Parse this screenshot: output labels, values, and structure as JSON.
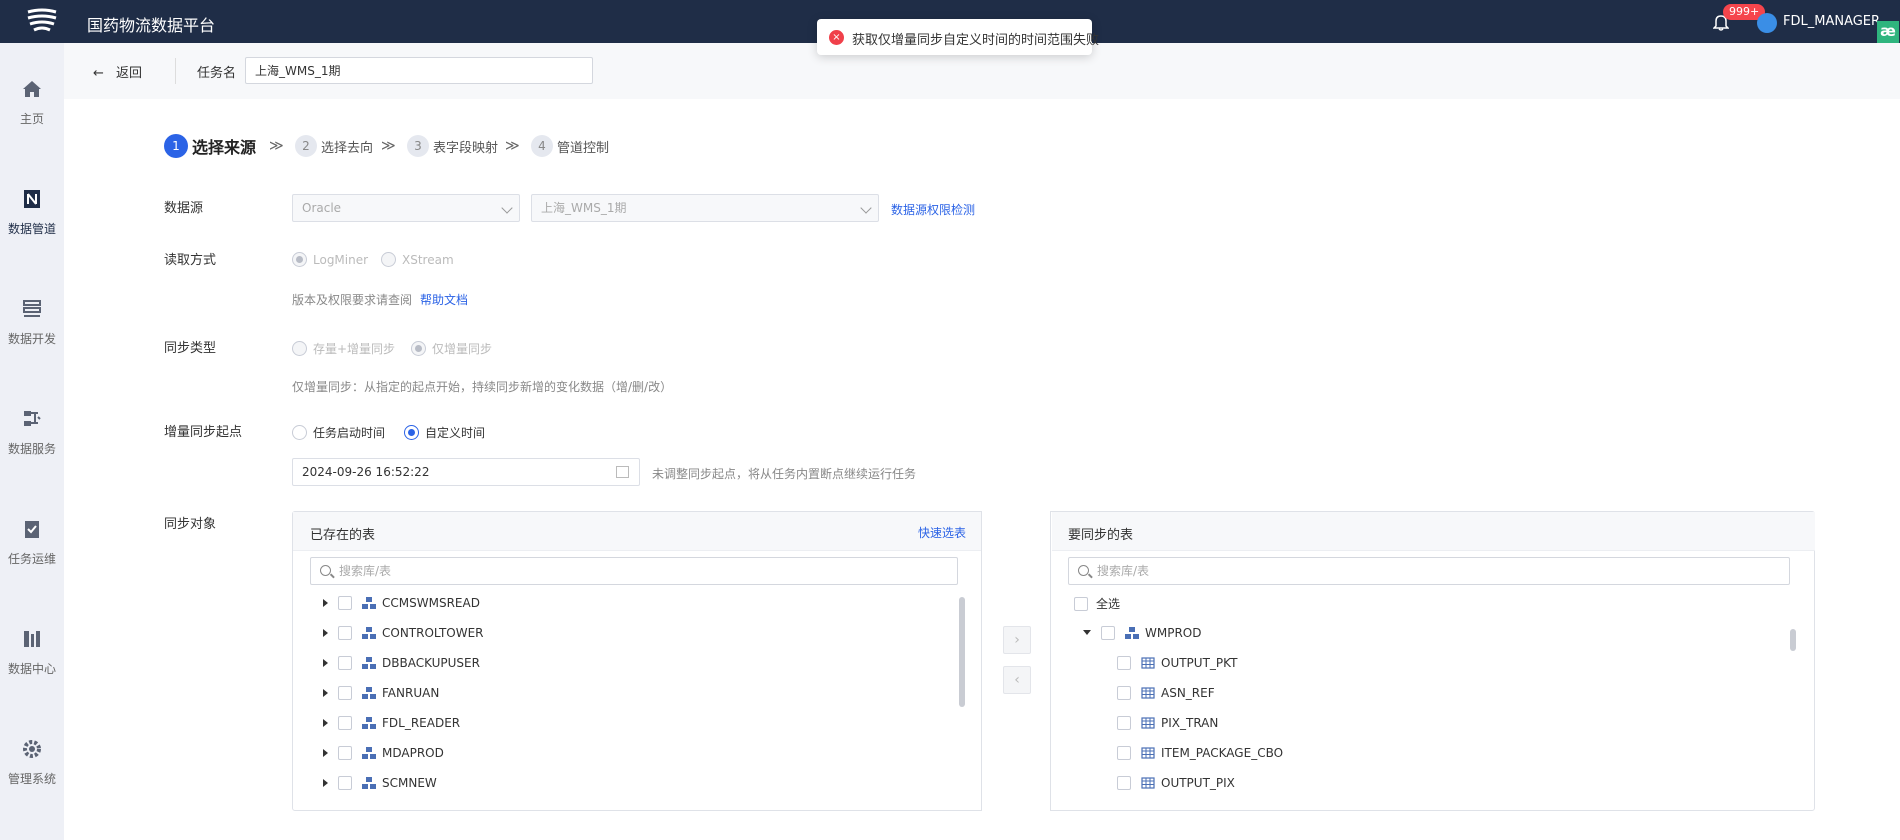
{
  "header": {
    "title": "国药物流数据平台",
    "badge": "999+",
    "user": "FDL_MANAGER",
    "corner": "æ"
  },
  "toast": {
    "icon": "×",
    "message": "获取仅增量同步自定义时间的时间范围失败"
  },
  "sidebar": {
    "items": [
      {
        "label": "主页",
        "icon": "home-icon"
      },
      {
        "label": "数据管道",
        "icon": "pipeline-icon"
      },
      {
        "label": "数据开发",
        "icon": "development-icon"
      },
      {
        "label": "数据服务",
        "icon": "service-icon"
      },
      {
        "label": "任务运维",
        "icon": "ops-icon"
      },
      {
        "label": "数据中心",
        "icon": "datacenter-icon"
      },
      {
        "label": "管理系统",
        "icon": "settings-icon"
      }
    ]
  },
  "subbar": {
    "back": "返回",
    "task_label": "任务名",
    "task_value": "上海_WMS_1期"
  },
  "steps": [
    {
      "num": "1",
      "label": "选择来源"
    },
    {
      "num": "2",
      "label": "选择去向"
    },
    {
      "num": "3",
      "label": "表字段映射"
    },
    {
      "num": "4",
      "label": "管道控制"
    }
  ],
  "form": {
    "datasource_label": "数据源",
    "datasource_type": "Oracle",
    "datasource_conn": "上海_WMS_1期",
    "perm_check": "数据源权限检测",
    "read_label": "读取方式",
    "read_opt1": "LogMiner",
    "read_opt2": "XStream",
    "version_hint": "版本及权限要求请查阅",
    "help_doc": "帮助文档",
    "sync_type_label": "同步类型",
    "sync_opt1": "存量+增量同步",
    "sync_opt2": "仅增量同步",
    "sync_hint": "仅增量同步：从指定的起点开始，持续同步新增的变化数据（增/删/改）",
    "start_label": "增量同步起点",
    "start_opt1": "任务启动时间",
    "start_opt2": "自定义时间",
    "start_value": "2024-09-26 16:52:22",
    "start_hint": "未调整同步起点，将从任务内置断点继续运行任务",
    "objects_label": "同步对象"
  },
  "left_panel": {
    "title": "已存在的表",
    "quick": "快速选表",
    "search_placeholder": "搜索库/表",
    "items": [
      "CCMSWMSREAD",
      "CONTROLTOWER",
      "DBBACKUPUSER",
      "FANRUAN",
      "FDL_READER",
      "MDAPROD",
      "SCMNEW"
    ]
  },
  "transfer": {
    "right_btn": "›",
    "left_btn": "‹"
  },
  "right_panel": {
    "title": "要同步的表",
    "search_placeholder": "搜索库/表",
    "select_all": "全选",
    "schema": "WMPROD",
    "tables": [
      "OUTPUT_PKT",
      "ASN_REF",
      "PIX_TRAN",
      "ITEM_PACKAGE_CBO",
      "OUTPUT_PIX"
    ]
  }
}
